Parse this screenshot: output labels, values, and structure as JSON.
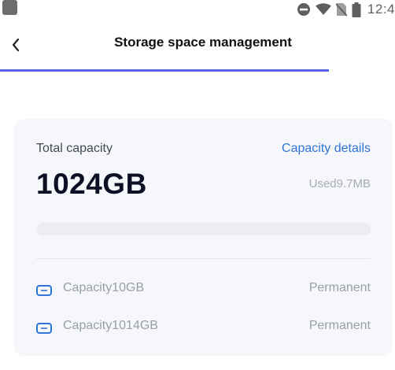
{
  "status_bar": {
    "time": "12:4",
    "icons": [
      "app-icon",
      "do-not-disturb-icon",
      "wifi-icon",
      "no-sim-icon",
      "battery-icon"
    ]
  },
  "header": {
    "title": "Storage space management",
    "back_icon": "chevron-left-icon"
  },
  "colors": {
    "accent": "#5865e5",
    "link": "#2f75d5",
    "card_bg": "#f6f7fb",
    "capacity_icon": "#2f75d5"
  },
  "storage": {
    "total_label": "Total capacity",
    "details_link": "Capacity details",
    "total_value": "1024GB",
    "used_text": "Used9.7MB",
    "used_fraction": 1e-05,
    "capacities": [
      {
        "name": "Capacity10GB",
        "status": "Permanent",
        "icon": "storage-drive-icon"
      },
      {
        "name": "Capacity1014GB",
        "status": "Permanent",
        "icon": "storage-drive-icon"
      }
    ]
  }
}
